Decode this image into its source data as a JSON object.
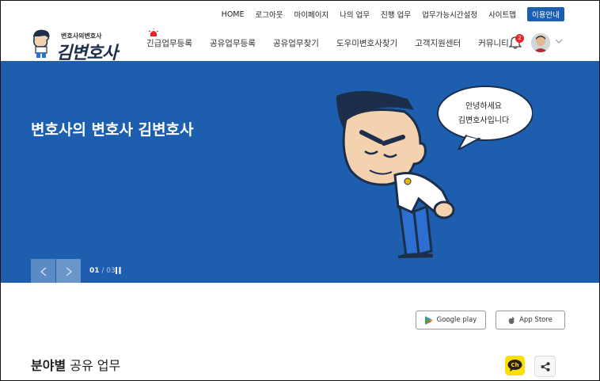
{
  "top_links": [
    "HOME",
    "로그아웃",
    "마이페이지",
    "나의 업무",
    "진행 업무",
    "업무가능시간설정",
    "사이트맵"
  ],
  "top_guide": "이용안내",
  "logo": {
    "small": "변호사의변호사",
    "big": "김변호사"
  },
  "nav": [
    "긴급업무등록",
    "공유업무등록",
    "공유업무찾기",
    "도우미변호사찾기",
    "고객지원센터",
    "커뮤니티"
  ],
  "notification_count": "2",
  "hero": {
    "title": "변호사의 변호사 김변호사",
    "bubble_line1": "안녕하세요",
    "bubble_line2": "김변호사입니다",
    "page_current": "01",
    "page_sep": " / ",
    "page_total": "03"
  },
  "stores": {
    "google": "Google play",
    "apple": "App Store"
  },
  "section": {
    "bold": "분야별",
    "rest": " 공유 업무"
  },
  "kakao_label": "Ch",
  "colors": {
    "brand_blue": "#1d5fae",
    "kakao_yellow": "#f9e000",
    "badge_red": "#e8262a"
  },
  "icons": [
    "siren-icon",
    "bell-icon",
    "chevron-down-icon",
    "arrow-left-icon",
    "arrow-right-icon",
    "pause-icon",
    "google-play-icon",
    "apple-icon",
    "kakao-channel-icon",
    "share-icon"
  ]
}
